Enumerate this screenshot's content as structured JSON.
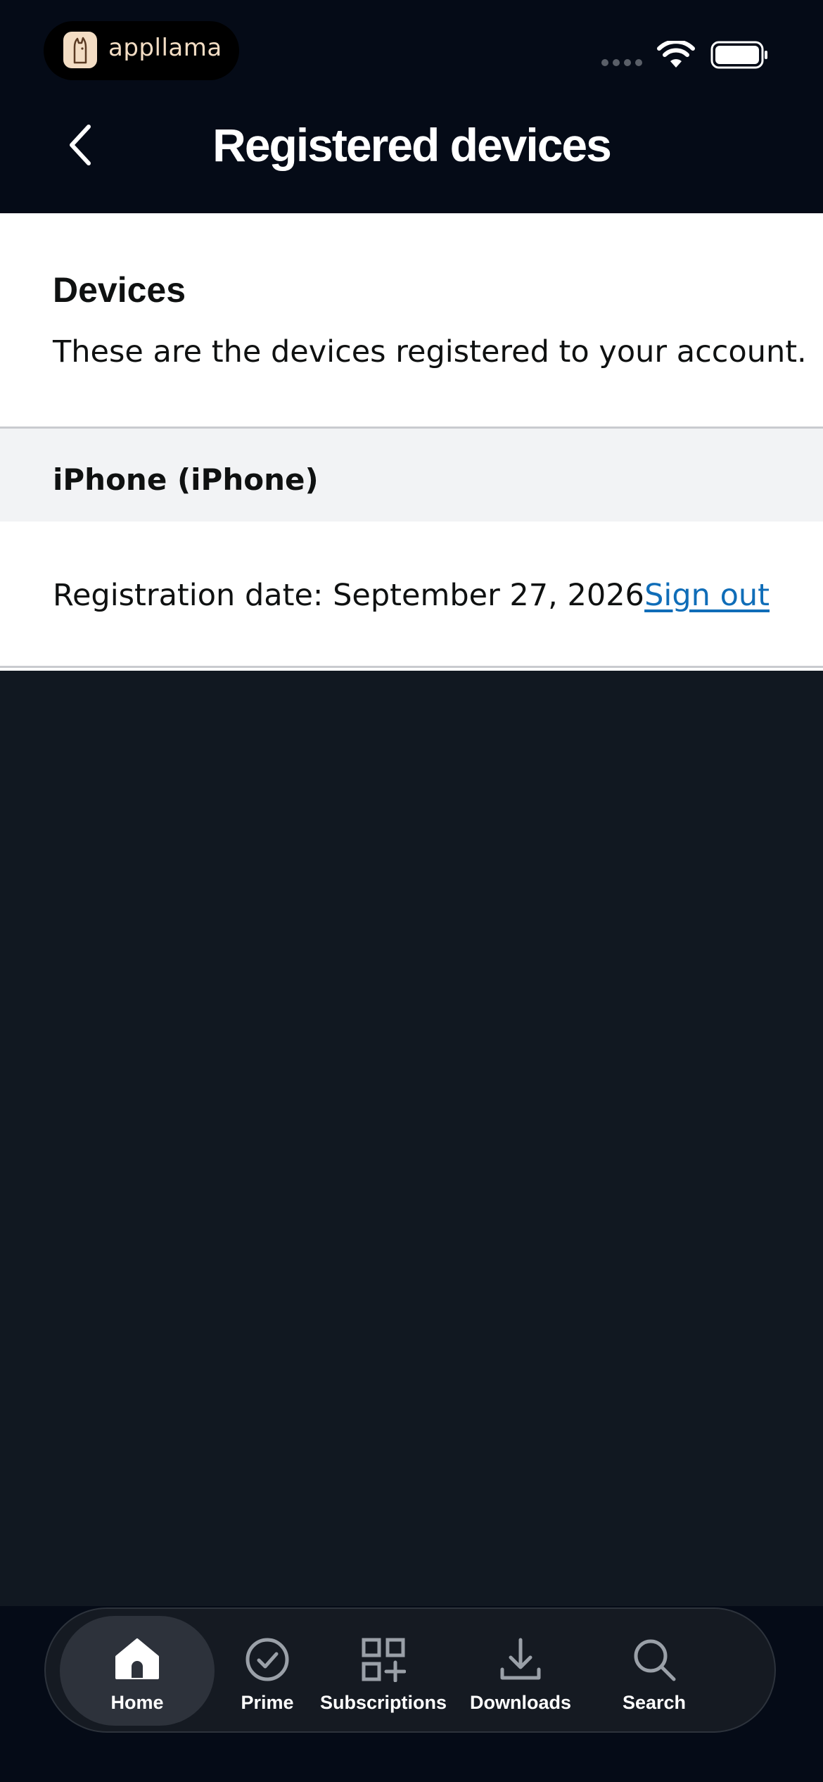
{
  "status_bar": {
    "brand": "appllama"
  },
  "header": {
    "title": "Registered devices"
  },
  "devices_section": {
    "title": "Devices",
    "description": "These are the devices registered to your account.",
    "devices": [
      {
        "name": "iPhone (iPhone)",
        "registration_text": "Registration date: September 27, 2026",
        "action_label": "Sign out"
      }
    ]
  },
  "bottom_nav": {
    "items": [
      {
        "label": "Home",
        "icon": "home-icon",
        "active": true
      },
      {
        "label": "Prime",
        "icon": "check-circle-icon",
        "active": false
      },
      {
        "label": "Subscriptions",
        "icon": "grid-plus-icon",
        "active": false
      },
      {
        "label": "Downloads",
        "icon": "download-icon",
        "active": false
      },
      {
        "label": "Search",
        "icon": "search-icon",
        "active": false
      }
    ]
  },
  "colors": {
    "header_bg": "#050b17",
    "page_bg": "#111821",
    "link": "#0f6db8",
    "brand": "#f3ddc4"
  }
}
